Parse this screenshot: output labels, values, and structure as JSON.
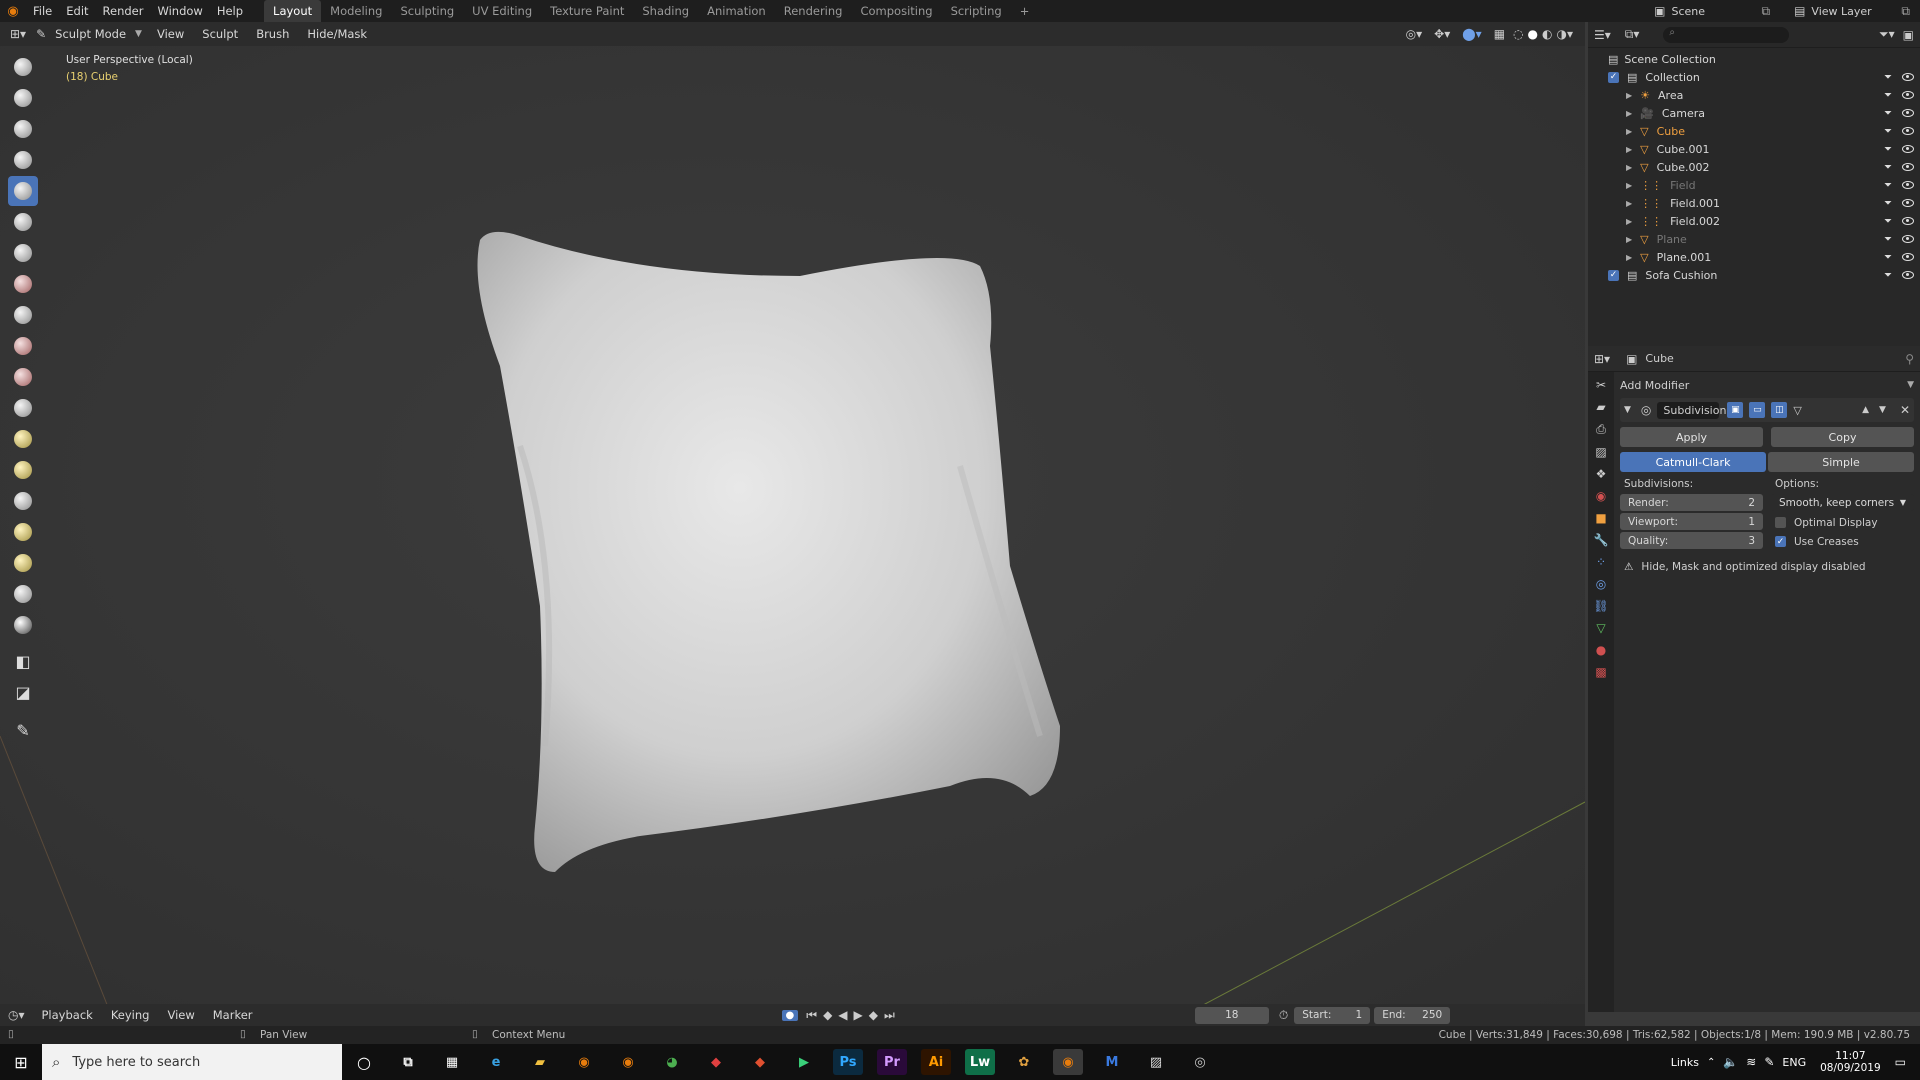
{
  "menubar": {
    "items": [
      "File",
      "Edit",
      "Render",
      "Window",
      "Help"
    ],
    "workspaces": [
      "Layout",
      "Modeling",
      "Sculpting",
      "UV Editing",
      "Texture Paint",
      "Shading",
      "Animation",
      "Rendering",
      "Compositing",
      "Scripting"
    ],
    "active_workspace": "Layout",
    "add": "+",
    "scene": "Scene",
    "view_layer": "View Layer"
  },
  "viewport_header": {
    "mode": "Sculpt Mode",
    "menus": [
      "View",
      "Sculpt",
      "Brush",
      "Hide/Mask"
    ]
  },
  "viewport": {
    "perspective": "User Perspective (Local)",
    "object_info": "(18) Cube"
  },
  "outliner": {
    "root": "Scene Collection",
    "items": [
      {
        "name": "Collection",
        "color": "#d8d8d8"
      },
      {
        "name": "Area",
        "color": "#d8d8d8"
      },
      {
        "name": "Camera",
        "color": "#d8d8d8"
      },
      {
        "name": "Cube",
        "color": "#f0a040"
      },
      {
        "name": "Cube.001",
        "color": "#d8d8d8"
      },
      {
        "name": "Cube.002",
        "color": "#d8d8d8"
      },
      {
        "name": "Field",
        "color": "#777777"
      },
      {
        "name": "Field.001",
        "color": "#d8d8d8"
      },
      {
        "name": "Field.002",
        "color": "#d8d8d8"
      },
      {
        "name": "Plane",
        "color": "#777777"
      },
      {
        "name": "Plane.001",
        "color": "#d8d8d8"
      },
      {
        "name": "Sofa Cushion",
        "color": "#d8d8d8"
      }
    ]
  },
  "properties": {
    "object": "Cube",
    "add_modifier": "Add Modifier",
    "modifier_name": "Subdivision",
    "apply": "Apply",
    "copy": "Copy",
    "catmull": "Catmull-Clark",
    "simple": "Simple",
    "subdivisions_label": "Subdivisions:",
    "options_label": "Options:",
    "render_label": "Render:",
    "render_value": "2",
    "viewport_label": "Viewport:",
    "viewport_value": "1",
    "quality_label": "Quality:",
    "quality_value": "3",
    "uv_smooth": "Smooth, keep corners",
    "optimal_display": "Optimal Display",
    "use_creases": "Use Creases",
    "warning": "Hide, Mask and optimized display disabled"
  },
  "timeline": {
    "menus": [
      "Playback",
      "Keying",
      "View",
      "Marker"
    ],
    "current_frame": "18",
    "start_label": "Start:",
    "start": "1",
    "end_label": "End:",
    "end": "250"
  },
  "statusbar": {
    "pan": "Pan View",
    "context": "Context Menu",
    "stats": "Cube | Verts:31,849 | Faces:30,698 | Tris:62,582 | Objects:1/8 | Mem: 190.9 MB | v2.80.75"
  },
  "taskbar": {
    "search_placeholder": "Type here to search",
    "links": "Links",
    "lang": "ENG",
    "time": "11:07",
    "date": "08/09/2019",
    "apps": [
      {
        "label": "Ps",
        "color": "#0b2a3f",
        "fg": "#31a8ff"
      },
      {
        "label": "Pr",
        "color": "#2a0a3a",
        "fg": "#d49bff"
      },
      {
        "label": "Ai",
        "color": "#2e1400",
        "fg": "#ff9a00"
      },
      {
        "label": "Lw",
        "color": "#0f6f48",
        "fg": "#ffffff"
      }
    ]
  }
}
